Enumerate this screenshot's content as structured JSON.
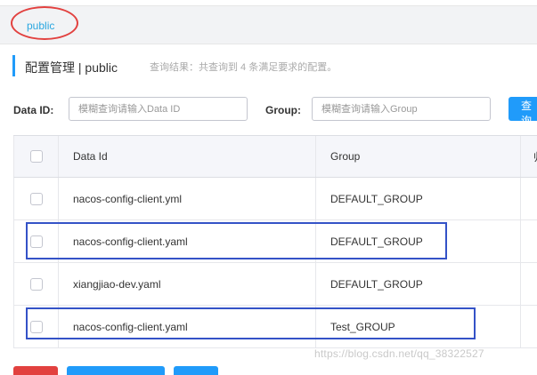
{
  "namespace": {
    "tab": "public"
  },
  "header": {
    "title": "配置管理 | public",
    "query_result": "查询结果：共查询到 4 条满足要求的配置。"
  },
  "search": {
    "data_id_label": "Data ID:",
    "data_id_placeholder": "模糊查询请输入Data ID",
    "group_label": "Group:",
    "group_placeholder": "模糊查询请输入Group",
    "query_button": "查询"
  },
  "table": {
    "columns": [
      "Data Id",
      "Group",
      "归"
    ],
    "rows": [
      {
        "data_id": "nacos-config-client.yml",
        "group": "DEFAULT_GROUP"
      },
      {
        "data_id": "nacos-config-client.yaml",
        "group": "DEFAULT_GROUP"
      },
      {
        "data_id": "xiangjiao-dev.yaml",
        "group": "DEFAULT_GROUP"
      },
      {
        "data_id": "nacos-config-client.yaml",
        "group": "Test_GROUP"
      }
    ]
  },
  "watermark": "https://blog.csdn.net/qq_38322527",
  "colors": {
    "accent": "#209bfa",
    "namespace_link": "#2aa7e0",
    "highlight_ellipse": "#e2413f",
    "highlight_box": "#3452c7",
    "delete_button": "#e2413f"
  }
}
